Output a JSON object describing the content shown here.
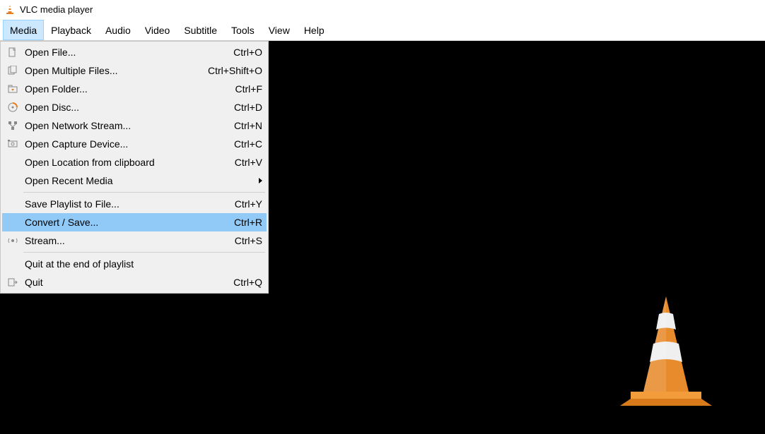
{
  "window": {
    "title": "VLC media player"
  },
  "menubar": {
    "items": [
      "Media",
      "Playback",
      "Audio",
      "Video",
      "Subtitle",
      "Tools",
      "View",
      "Help"
    ],
    "active_index": 0
  },
  "media_menu": {
    "groups": [
      [
        {
          "icon": "file-icon",
          "label": "Open File...",
          "shortcut": "Ctrl+O"
        },
        {
          "icon": "files-icon",
          "label": "Open Multiple Files...",
          "shortcut": "Ctrl+Shift+O"
        },
        {
          "icon": "folder-icon",
          "label": "Open Folder...",
          "shortcut": "Ctrl+F"
        },
        {
          "icon": "disc-icon",
          "label": "Open Disc...",
          "shortcut": "Ctrl+D"
        },
        {
          "icon": "network-icon",
          "label": "Open Network Stream...",
          "shortcut": "Ctrl+N"
        },
        {
          "icon": "capture-icon",
          "label": "Open Capture Device...",
          "shortcut": "Ctrl+C"
        },
        {
          "icon": "",
          "label": "Open Location from clipboard",
          "shortcut": "Ctrl+V"
        },
        {
          "icon": "",
          "label": "Open Recent Media",
          "shortcut": "",
          "submenu": true
        }
      ],
      [
        {
          "icon": "",
          "label": "Save Playlist to File...",
          "shortcut": "Ctrl+Y"
        },
        {
          "icon": "",
          "label": "Convert / Save...",
          "shortcut": "Ctrl+R",
          "highlight": true
        },
        {
          "icon": "stream-icon",
          "label": "Stream...",
          "shortcut": "Ctrl+S"
        }
      ],
      [
        {
          "icon": "",
          "label": "Quit at the end of playlist",
          "shortcut": ""
        },
        {
          "icon": "quit-icon",
          "label": "Quit",
          "shortcut": "Ctrl+Q"
        }
      ]
    ]
  }
}
